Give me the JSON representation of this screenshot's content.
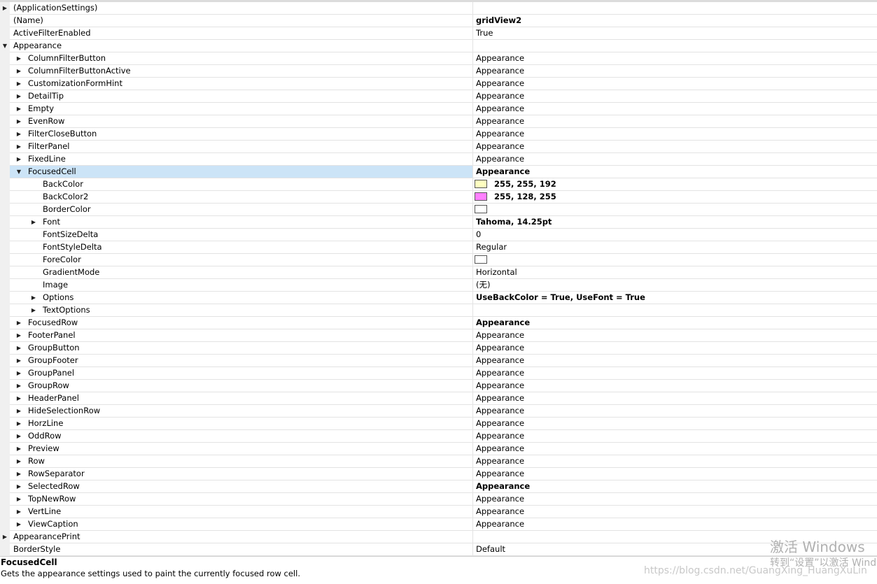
{
  "rows": [
    {
      "label": "(ApplicationSettings)",
      "value": "",
      "level": 0,
      "exp": "collapsed"
    },
    {
      "label": "(Name)",
      "value": "gridView2",
      "level": 0,
      "exp": "none",
      "bold": true
    },
    {
      "label": "ActiveFilterEnabled",
      "value": "True",
      "level": 0,
      "exp": "none"
    },
    {
      "label": "Appearance",
      "value": "",
      "level": 0,
      "exp": "expanded"
    },
    {
      "label": "ColumnFilterButton",
      "value": "Appearance",
      "level": 1,
      "exp": "collapsed"
    },
    {
      "label": "ColumnFilterButtonActive",
      "value": "Appearance",
      "level": 1,
      "exp": "collapsed"
    },
    {
      "label": "CustomizationFormHint",
      "value": "Appearance",
      "level": 1,
      "exp": "collapsed"
    },
    {
      "label": "DetailTip",
      "value": "Appearance",
      "level": 1,
      "exp": "collapsed"
    },
    {
      "label": "Empty",
      "value": "Appearance",
      "level": 1,
      "exp": "collapsed"
    },
    {
      "label": "EvenRow",
      "value": "Appearance",
      "level": 1,
      "exp": "collapsed"
    },
    {
      "label": "FilterCloseButton",
      "value": "Appearance",
      "level": 1,
      "exp": "collapsed"
    },
    {
      "label": "FilterPanel",
      "value": "Appearance",
      "level": 1,
      "exp": "collapsed"
    },
    {
      "label": "FixedLine",
      "value": "Appearance",
      "level": 1,
      "exp": "collapsed"
    },
    {
      "label": "FocusedCell",
      "value": "Appearance",
      "level": 1,
      "exp": "expanded",
      "bold": true,
      "selected": true
    },
    {
      "label": "BackColor",
      "value": "255, 255, 192",
      "level": 2,
      "exp": "none",
      "bold": true,
      "swatch": "#ffffc0"
    },
    {
      "label": "BackColor2",
      "value": "255, 128, 255",
      "level": 2,
      "exp": "none",
      "bold": true,
      "swatch": "#ff80ff"
    },
    {
      "label": "BorderColor",
      "value": "",
      "level": 2,
      "exp": "none",
      "swatch": "#ffffff"
    },
    {
      "label": "Font",
      "value": "Tahoma, 14.25pt",
      "level": 2,
      "exp": "collapsed",
      "bold": true
    },
    {
      "label": "FontSizeDelta",
      "value": "0",
      "level": 2,
      "exp": "none"
    },
    {
      "label": "FontStyleDelta",
      "value": "Regular",
      "level": 2,
      "exp": "none"
    },
    {
      "label": "ForeColor",
      "value": "",
      "level": 2,
      "exp": "none",
      "swatch": "#ffffff"
    },
    {
      "label": "GradientMode",
      "value": "Horizontal",
      "level": 2,
      "exp": "none"
    },
    {
      "label": "Image",
      "value": "(无)",
      "level": 2,
      "exp": "none"
    },
    {
      "label": "Options",
      "value": "UseBackColor = True, UseFont = True",
      "level": 2,
      "exp": "collapsed",
      "bold": true
    },
    {
      "label": "TextOptions",
      "value": "",
      "level": 2,
      "exp": "collapsed"
    },
    {
      "label": "FocusedRow",
      "value": "Appearance",
      "level": 1,
      "exp": "collapsed",
      "bold": true
    },
    {
      "label": "FooterPanel",
      "value": "Appearance",
      "level": 1,
      "exp": "collapsed"
    },
    {
      "label": "GroupButton",
      "value": "Appearance",
      "level": 1,
      "exp": "collapsed"
    },
    {
      "label": "GroupFooter",
      "value": "Appearance",
      "level": 1,
      "exp": "collapsed"
    },
    {
      "label": "GroupPanel",
      "value": "Appearance",
      "level": 1,
      "exp": "collapsed"
    },
    {
      "label": "GroupRow",
      "value": "Appearance",
      "level": 1,
      "exp": "collapsed"
    },
    {
      "label": "HeaderPanel",
      "value": "Appearance",
      "level": 1,
      "exp": "collapsed"
    },
    {
      "label": "HideSelectionRow",
      "value": "Appearance",
      "level": 1,
      "exp": "collapsed"
    },
    {
      "label": "HorzLine",
      "value": "Appearance",
      "level": 1,
      "exp": "collapsed"
    },
    {
      "label": "OddRow",
      "value": "Appearance",
      "level": 1,
      "exp": "collapsed"
    },
    {
      "label": "Preview",
      "value": "Appearance",
      "level": 1,
      "exp": "collapsed"
    },
    {
      "label": "Row",
      "value": "Appearance",
      "level": 1,
      "exp": "collapsed"
    },
    {
      "label": "RowSeparator",
      "value": "Appearance",
      "level": 1,
      "exp": "collapsed"
    },
    {
      "label": "SelectedRow",
      "value": "Appearance",
      "level": 1,
      "exp": "collapsed",
      "bold": true
    },
    {
      "label": "TopNewRow",
      "value": "Appearance",
      "level": 1,
      "exp": "collapsed"
    },
    {
      "label": "VertLine",
      "value": "Appearance",
      "level": 1,
      "exp": "collapsed"
    },
    {
      "label": "ViewCaption",
      "value": "Appearance",
      "level": 1,
      "exp": "collapsed"
    },
    {
      "label": "AppearancePrint",
      "value": "",
      "level": 0,
      "exp": "collapsed"
    },
    {
      "label": "BorderStyle",
      "value": "Default",
      "level": 0,
      "exp": "none"
    }
  ],
  "description": {
    "title": "FocusedCell",
    "text": "Gets the appearance settings used to paint the currently focused row cell."
  },
  "watermark": {
    "line1": "激活 Windows",
    "line2": "转到“设置”以激活 Windows",
    "line3": "https://blog.csdn.net/GuangXing_HuangXuLin"
  },
  "colors": {
    "selection": "#cce4f7",
    "grid_line": "#e3e3e3",
    "gutter": "#f0f0f0"
  }
}
